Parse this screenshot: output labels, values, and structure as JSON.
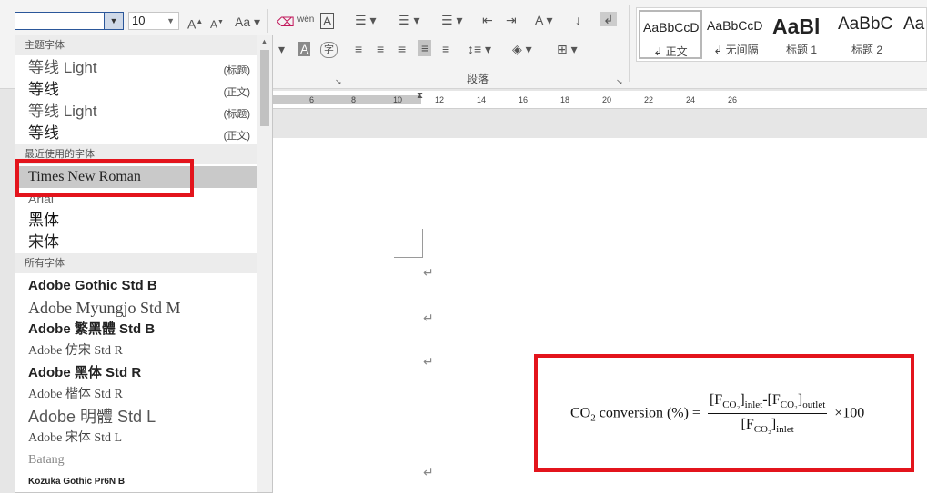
{
  "ribbon": {
    "font_name_value": "",
    "font_size_value": "10",
    "section_label": "段落",
    "styles": [
      {
        "preview": "AaBbCcD",
        "label": "↲ 正文",
        "selected": true
      },
      {
        "preview": "AaBbCcD",
        "label": "↲ 无间隔",
        "selected": false
      },
      {
        "preview": "AaBl",
        "label": "标题 1",
        "selected": false
      },
      {
        "preview": "AaBbC",
        "label": "标题 2",
        "selected": false
      },
      {
        "preview": "Aa",
        "label": "标",
        "selected": false
      }
    ]
  },
  "ruler": {
    "ticks": [
      "6",
      "8",
      "10",
      "12",
      "14",
      "16",
      "18",
      "20",
      "22",
      "24",
      "26"
    ]
  },
  "font_dropdown": {
    "sections": [
      {
        "header": "主题字体",
        "items": [
          {
            "name": "等线 Light",
            "tag": "(标题)"
          },
          {
            "name": "等线",
            "tag": "(正文)"
          },
          {
            "name": "等线 Light",
            "tag": "(标题)"
          },
          {
            "name": "等线",
            "tag": "(正文)"
          }
        ]
      },
      {
        "header": "最近使用的字体",
        "items": [
          {
            "name": "Times New Roman",
            "tag": ""
          },
          {
            "name": "Arial",
            "tag": ""
          },
          {
            "name": "黑体",
            "tag": ""
          },
          {
            "name": "宋体",
            "tag": ""
          }
        ]
      },
      {
        "header": "所有字体",
        "items": [
          {
            "name": "Adobe Gothic Std B",
            "tag": ""
          },
          {
            "name": "Adobe Myungjo Std M",
            "tag": ""
          },
          {
            "name": "Adobe 繁黑體 Std B",
            "tag": ""
          },
          {
            "name": "Adobe 仿宋 Std R",
            "tag": ""
          },
          {
            "name": "Adobe 黑体 Std R",
            "tag": ""
          },
          {
            "name": "Adobe 楷体 Std R",
            "tag": ""
          },
          {
            "name": "Adobe 明體 Std L",
            "tag": ""
          },
          {
            "name": "Adobe 宋体 Std L",
            "tag": ""
          },
          {
            "name": "Batang",
            "tag": ""
          },
          {
            "name": "Kozuka Gothic Pr6N B",
            "tag": ""
          }
        ]
      }
    ],
    "highlighted_item": "Times New Roman"
  },
  "document": {
    "formula": {
      "left_text": "CO",
      "left_sub": "2",
      "left_rest": " conversion (%) = ",
      "num_a": "[F",
      "num_a_sub": "CO₂",
      "num_a_close": "]",
      "num_a_tail": "inlet",
      "num_dash": "-[F",
      "num_b_sub": "CO₂",
      "num_b_close": "]",
      "num_b_tail": "outlet",
      "den": "[F",
      "den_sub": "CO₂",
      "den_close": "]",
      "den_tail": "inlet",
      "suffix": " ×100"
    }
  }
}
